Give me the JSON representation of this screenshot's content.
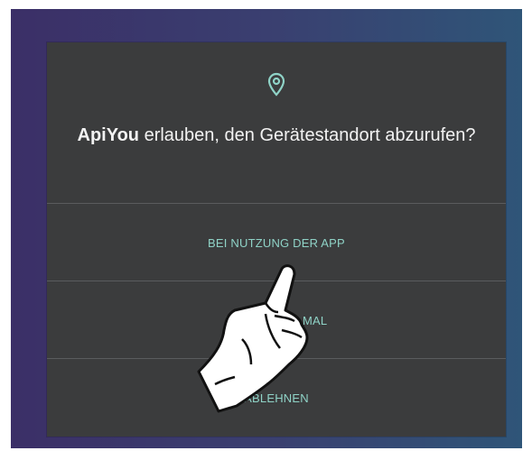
{
  "dialog": {
    "app_name": "ApiYou",
    "message": " erlauben, den Gerätestandort abzurufen?",
    "options": [
      {
        "label": "BEI NUTZUNG DER APP"
      },
      {
        "label": "NUR DIESES MAL"
      },
      {
        "label": "ABLEHNEN"
      }
    ],
    "icon": "location-pin-icon"
  },
  "colors": {
    "dialog_bg": "#3b3c3d",
    "option_text": "#8fd3c7",
    "title_text": "#f2f2f2"
  },
  "overlay": {
    "icon": "pointing-hand-icon"
  }
}
